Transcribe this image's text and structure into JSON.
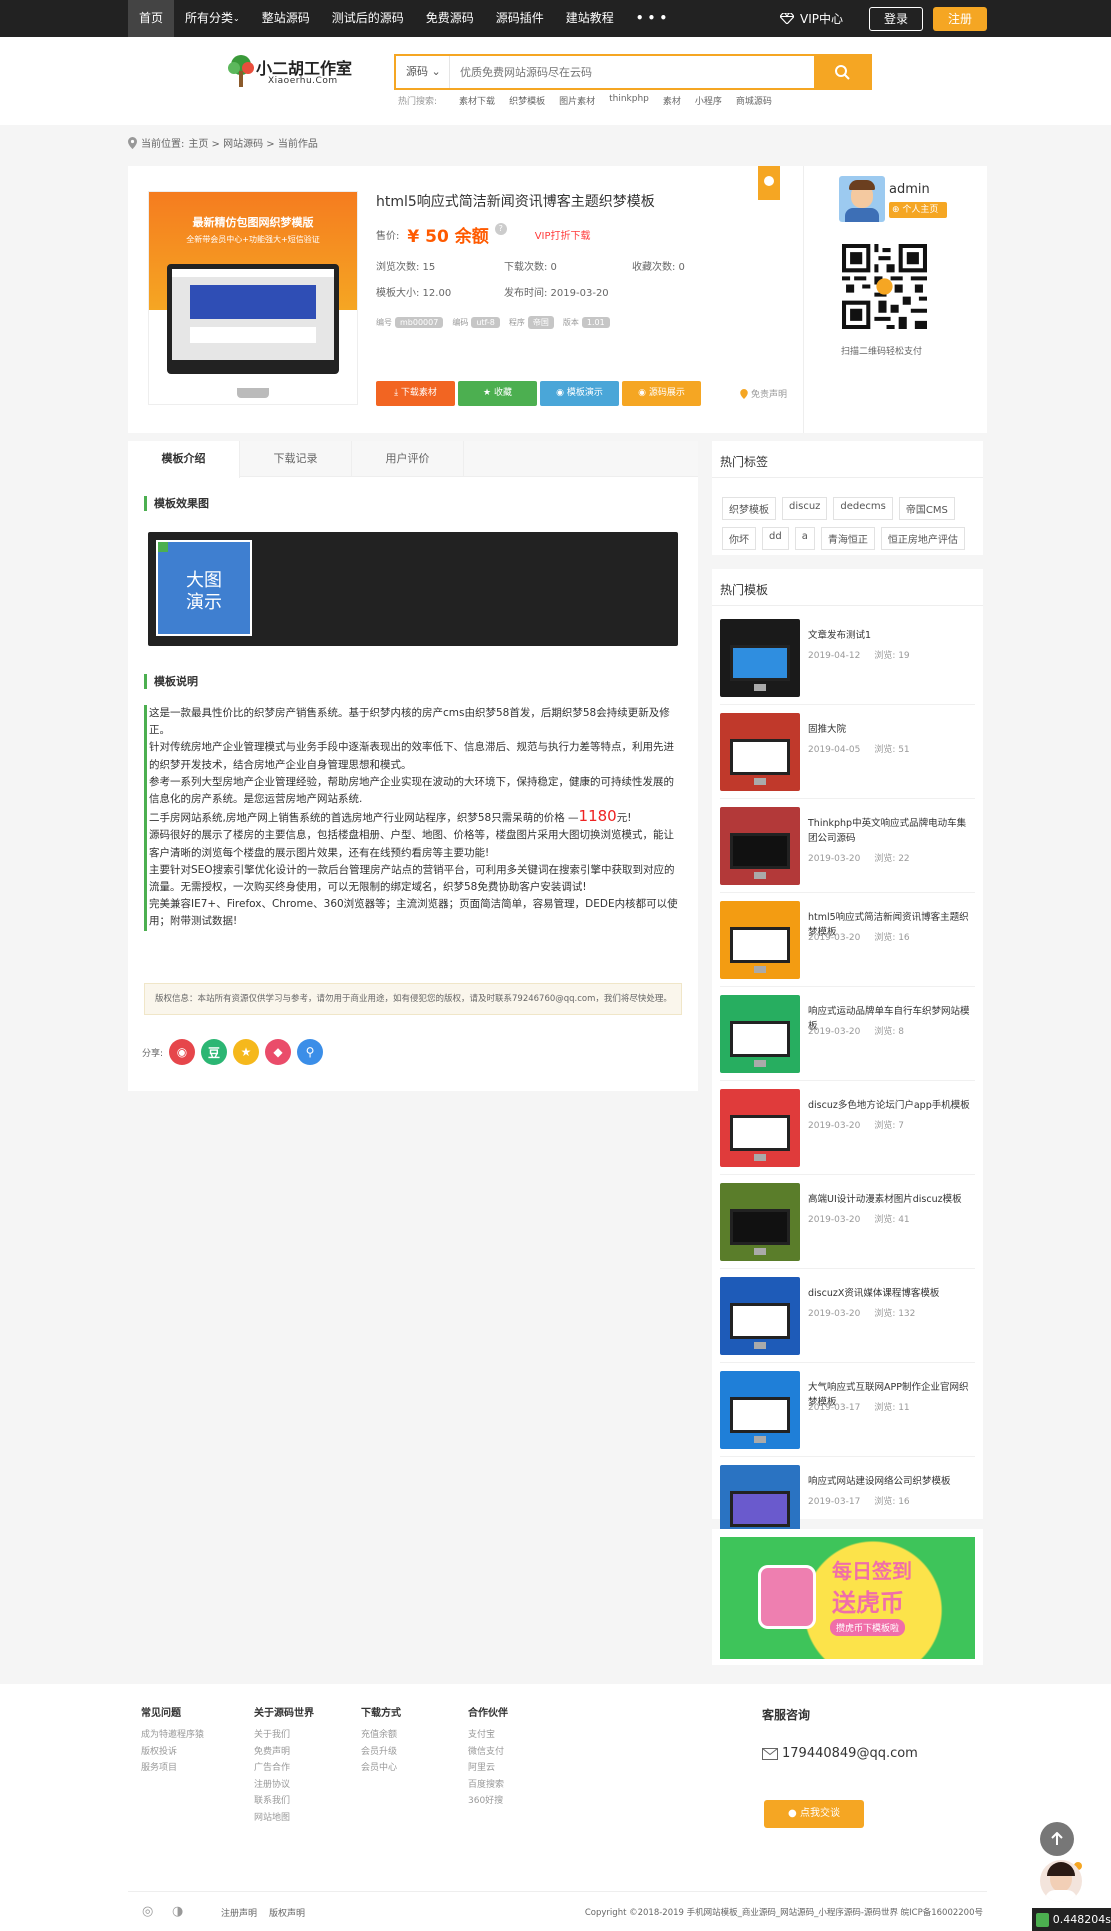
{
  "nav": {
    "items": [
      "首页",
      "所有分类",
      "整站源码",
      "测试后的源码",
      "免费源码",
      "源码插件",
      "建站教程",
      "• • •"
    ],
    "vip": "VIP中心",
    "login": "登录",
    "register": "注册"
  },
  "header": {
    "logo_title": "小二胡工作室",
    "logo_sub": "Xiaoerhu.Com",
    "search_select": "源码",
    "search_placeholder": "优质免费网站源码尽在云码",
    "hot_label": "热门搜索:",
    "hot_terms": [
      "素材下载",
      "织梦模板",
      "图片素材",
      "thinkphp",
      "素材",
      "小程序",
      "商城源码"
    ]
  },
  "breadcrumb": {
    "label": "当前位置:",
    "path": "主页 > 网站源码 > 当前作品"
  },
  "product": {
    "thumb_title": "最新精仿包图网织梦模版",
    "thumb_sub": "全新带会员中心+功能强大+短信验证",
    "title": "html5响应式简洁新闻资讯博客主题织梦模板",
    "price_label": "售价:",
    "price": "¥ 50 余额",
    "vip_download": "VIP打折下载",
    "views": "浏览次数: 15",
    "downloads": "下载次数: 0",
    "favorites": "收藏次数: 0",
    "size": "模板大小: 12.00",
    "published": "发布时间: 2019-03-20",
    "tag_labels": [
      "编号",
      "编码",
      "程序",
      "版本"
    ],
    "tag_values": [
      "mb00007",
      "utf-8",
      "帝国",
      "1.01"
    ],
    "buttons": [
      "下载素材",
      "收藏",
      "模板演示",
      "源码展示"
    ],
    "disclaimer": "免责声明"
  },
  "author": {
    "name": "admin",
    "home": "个人主页",
    "qr_caption": "扫描二维码轻松支付"
  },
  "tabs": [
    "模板介绍",
    "下载记录",
    "用户评价"
  ],
  "section_effect": "模板效果图",
  "gallery_label": "大图\n演示",
  "section_desc": "模板说明",
  "description": {
    "p1": "这是一款最具性价比的织梦房产销售系统。基于织梦内核的房产cms由织梦58首发，后期织梦58会持续更新及修正。",
    "p2": "针对传统房地产企业管理模式与业务手段中逐渐表现出的效率低下、信息滞后、规范与执行力差等特点，利用先进的织梦开发技术，结合房地产企业自身管理思想和模式。",
    "p3": "参考一系列大型房地产企业管理经验，帮助房地产企业实现在波动的大环境下，保持稳定，健康的可持续性发展的信息化的房产系统。是您运营房地产网站系统.",
    "p4a": "二手房网站系统,房地产网上销售系统的首选房地产行业网站程序，织梦58只需呆萌的价格 —",
    "p4b": "1180",
    "p4c": "元!",
    "p5": "源码很好的展示了楼房的主要信息，包括楼盘相册、户型、地图、价格等，楼盘图片采用大图切换浏览模式，能让客户清晰的浏览每个楼盘的展示图片效果，还有在线预约看房等主要功能!",
    "p6": "主要针对SEO搜索引擎优化设计的一款后台管理房产站点的营销平台，可利用多关键词在搜索引擎中获取到对应的流量。无需授权，一次购买终身使用，可以无限制的绑定域名，织梦58免费协助客户安装调试!",
    "p7": "完美兼容IE7+、Firefox、Chrome、360浏览器等；主流浏览器；页面简洁简单，容易管理，DEDE内核都可以使用；附带测试数据!"
  },
  "copyright": "版权信息：本站所有资源仅供学习与参考，请勿用于商业用途，如有侵犯您的版权，请及时联系79246760@qq.com，我们将尽快处理。",
  "share_label": "分享:",
  "hot_tags": {
    "title": "热门标签",
    "tags": [
      "织梦模板",
      "discuz",
      "dedecms",
      "帝国CMS",
      "你坏",
      "dd",
      "a",
      "青海恒正",
      "恒正房地产评估"
    ]
  },
  "hot_templates": {
    "title": "热门模板",
    "items": [
      {
        "title": "文章发布测试1",
        "date": "2019-04-12",
        "views": "浏览: 19"
      },
      {
        "title": "固推大院",
        "date": "2019-04-05",
        "views": "浏览: 51"
      },
      {
        "title": "Thinkphp中英文响应式品牌电动车集团公司源码",
        "date": "2019-03-20",
        "views": "浏览: 22"
      },
      {
        "title": "html5响应式简洁新闻资讯博客主题织梦模板",
        "date": "2019-03-20",
        "views": "浏览: 16"
      },
      {
        "title": "响应式运动品牌单车自行车织梦网站模板",
        "date": "2019-03-20",
        "views": "浏览: 8"
      },
      {
        "title": "discuz多色地方论坛门户app手机模板",
        "date": "2019-03-20",
        "views": "浏览: 7"
      },
      {
        "title": "高端UI设计动漫素材图片discuz模板",
        "date": "2019-03-20",
        "views": "浏览: 41"
      },
      {
        "title": "discuzX资讯媒体课程博客模板",
        "date": "2019-03-20",
        "views": "浏览: 132"
      },
      {
        "title": "大气响应式互联网APP制作企业官网织梦模板",
        "date": "2019-03-17",
        "views": "浏览: 11"
      },
      {
        "title": "响应式网站建设网络公司织梦模板",
        "date": "2019-03-17",
        "views": "浏览: 16"
      }
    ]
  },
  "ad": {
    "line1": "每日签到",
    "line2": "送虎币",
    "line3": "攒虎币下模板啦"
  },
  "footer": {
    "cols": [
      {
        "title": "常见问题",
        "links": [
          "成为特邀程序猿",
          "版权投诉",
          "服务项目"
        ]
      },
      {
        "title": "关于源码世界",
        "links": [
          "关于我们",
          "免费声明",
          "广告合作",
          "注册协议",
          "联系我们",
          "网站地图"
        ]
      },
      {
        "title": "下载方式",
        "links": [
          "充值余额",
          "会员升级",
          "会员中心"
        ]
      },
      {
        "title": "合作伙伴",
        "links": [
          "支付宝",
          "微信支付",
          "阿里云",
          "百度搜索",
          "360好搜"
        ]
      }
    ],
    "service_title": "客服咨询",
    "email": "179440849@qq.com",
    "consult": "点我交谈",
    "bottom_links": [
      "注册声明",
      "版权声明"
    ],
    "copyright": "Copyright ©2018-2019 手机网站模板_商业源码_网站源码_小程序源码-源码世界 皖ICP备16002200号"
  },
  "speed": "0.448204s",
  "colors": {
    "accent": "#f5a623",
    "green": "#4caf50",
    "dark": "#222222"
  }
}
